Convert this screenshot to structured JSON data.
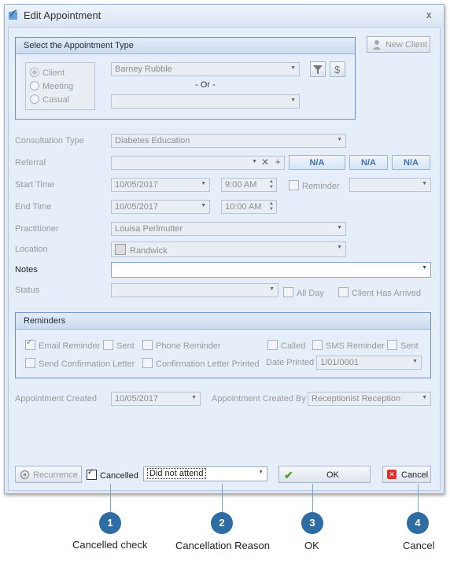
{
  "window": {
    "title": "Edit Appointment",
    "close": "x"
  },
  "type_group": {
    "heading": "Select the Appointment Type",
    "new_client": "New Client",
    "options": [
      "Client",
      "Meeting",
      "Casual"
    ],
    "client_value": "Barney Rubble",
    "or_text": "- Or -",
    "casual_value": ""
  },
  "form": {
    "consultation_label": "Consultation Type",
    "consultation_value": "Diabetes Education",
    "referral_label": "Referral",
    "referral_value": "",
    "na_labels": [
      "N/A",
      "N/A",
      "N/A"
    ],
    "start_label": "Start Time",
    "start_date": "10/05/2017",
    "start_time": "9:00 AM",
    "reminder_label": "Reminder",
    "reminder_value": "",
    "end_label": "End Time",
    "end_date": "10/05/2017",
    "end_time": "10:00 AM",
    "practitioner_label": "Practitioner",
    "practitioner_value": "Louisa Perlmutter",
    "location_label": "Location",
    "location_value": "Randwick",
    "notes_label": "Notes",
    "notes_value": "",
    "status_label": "Status",
    "status_value": "",
    "all_day_label": "All Day",
    "client_arrived_label": "Client Has Arrived"
  },
  "reminders": {
    "heading": "Reminders",
    "email_reminder": "Email Reminder",
    "sent1": "Sent",
    "phone_reminder": "Phone Reminder",
    "called": "Called",
    "sms_reminder": "SMS Reminder",
    "sent2": "Sent",
    "send_confirmation": "Send Confirmation Letter",
    "confirmation_printed": "Confirmation Letter Printed",
    "date_printed_label": "Date Printed",
    "date_printed_value": "1/01/0001"
  },
  "created": {
    "label": "Appointment Created",
    "value": "10/05/2017",
    "by_label": "Appointment Created By",
    "by_value": "Receptionist Reception"
  },
  "footer": {
    "recurrence": "Recurrence",
    "cancelled": "Cancelled",
    "cancel_reason": "Did not attend",
    "ok": "OK",
    "cancel": "Cancel"
  },
  "callouts": [
    {
      "num": "1",
      "label": "Cancelled check"
    },
    {
      "num": "2",
      "label": "Cancellation Reason"
    },
    {
      "num": "3",
      "label": "OK"
    },
    {
      "num": "4",
      "label": "Cancel"
    }
  ],
  "colors": {
    "accent": "#2e6da4",
    "group_border": "#6f8fc1",
    "na_text": "#3f6fb0"
  }
}
